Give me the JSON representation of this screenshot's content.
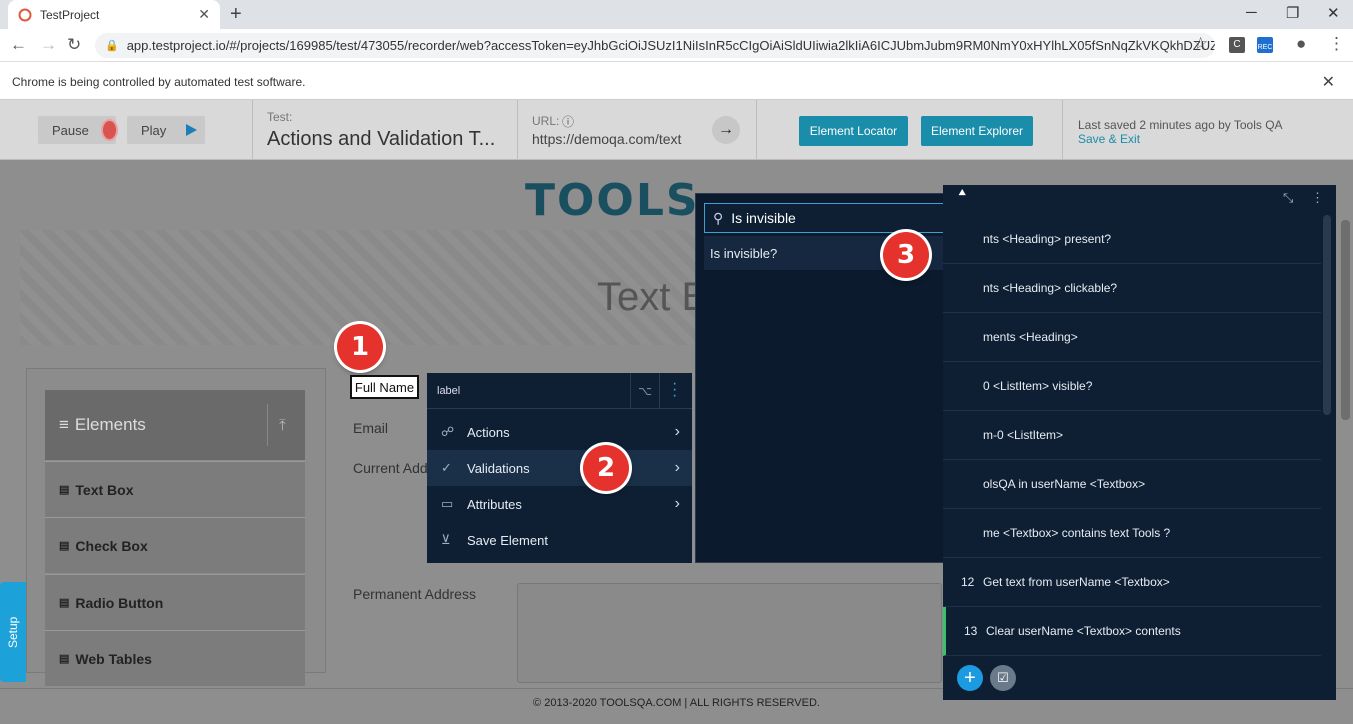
{
  "browser": {
    "tab_title": "TestProject",
    "url": "app.testproject.io/#/projects/169985/test/473055/recorder/web?accessToken=eyJhbGciOiJSUzI1NiIsInR5cCIgOiAiSldUIiwia2lkIiA6ICJUbmJubm9RM0NmY0xHYlhLX05fSnNqZkVKQkhDZUZCOHB...",
    "ext_c_label": "C",
    "ext_rec_label": "REC",
    "automation_notice": "Chrome is being controlled by automated test software."
  },
  "recorder": {
    "pause_label": "Pause",
    "play_label": "Play",
    "test_label": "Test:",
    "test_name": "Actions and Validation T...",
    "url_label": "URL:",
    "url_value": "https://demoqa.com/text",
    "element_locator": "Element Locator",
    "element_explorer": "Element Explorer",
    "last_saved": "Last saved 2 minutes ago by Tools QA",
    "save_exit": "Save & Exit"
  },
  "page": {
    "logo_text": "TOOLS",
    "title": "Text B",
    "sidebar_header": "Elements",
    "sidebar_items": [
      "Text Box",
      "Check Box",
      "Radio Button",
      "Web Tables"
    ],
    "labels": {
      "full_name": "Full Name",
      "email": "Email",
      "current_address": "Current Add",
      "permanent_address": "Permanent Address"
    },
    "footer": "© 2013-2020 TOOLSQA.COM | ALL RIGHTS RESERVED.",
    "setup_tab": "Setup"
  },
  "context_menu": {
    "header_label": "label",
    "items": [
      "Actions",
      "Validations",
      "Attributes",
      "Save Element"
    ]
  },
  "validations_panel": {
    "search_query": "Is invisible",
    "result": "Is invisible?"
  },
  "steps": [
    {
      "num": "",
      "text": "nts <Heading> present?"
    },
    {
      "num": "",
      "text": "nts <Heading> clickable?"
    },
    {
      "num": "",
      "text": "ments <Heading>"
    },
    {
      "num": "",
      "text": "0 <ListItem> visible?"
    },
    {
      "num": "",
      "text": "m-0 <ListItem>"
    },
    {
      "num": "",
      "text": "olsQA in userName <Textbox>"
    },
    {
      "num": "",
      "text": "me <Textbox> contains text Tools ?"
    },
    {
      "num": "12",
      "text": "Get text from userName <Textbox>"
    },
    {
      "num": "13",
      "text": "Clear userName <Textbox> contents"
    }
  ],
  "badges": [
    "1",
    "2",
    "3"
  ],
  "colors": {
    "accent": "#1a8dab",
    "dark_panel": "#0f1f33",
    "badge_red": "#e5322d"
  }
}
